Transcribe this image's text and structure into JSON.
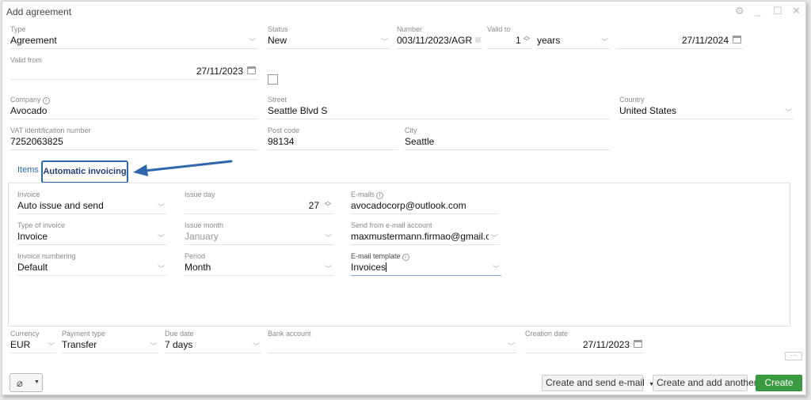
{
  "window": {
    "title": "Add agreement",
    "controls": [
      "⚙",
      "_",
      "☐",
      "✕"
    ]
  },
  "header": {
    "type": {
      "label": "Type",
      "value": "Agreement"
    },
    "status": {
      "label": "Status",
      "value": "New"
    },
    "number": {
      "label": "Number",
      "value": "003/11/2023/AGR"
    },
    "valid_to": {
      "label": "Valid to",
      "amount": "1",
      "unit": "years",
      "date": "27/11/2024"
    },
    "valid_from": {
      "label": "Valid from",
      "value": "27/11/2023"
    }
  },
  "company": {
    "company": {
      "label": "Company",
      "value": "Avocado"
    },
    "street": {
      "label": "Street",
      "value": "Seattle Blvd S"
    },
    "country": {
      "label": "Country",
      "value": "United States"
    },
    "vat": {
      "label": "VAT identification number",
      "value": "7252063825"
    },
    "post_code": {
      "label": "Post code",
      "value": "98134"
    },
    "city": {
      "label": "City",
      "value": "Seattle"
    }
  },
  "tabs": {
    "items": "Items",
    "automatic_invoicing": "Automatic invoicing"
  },
  "invoicing": {
    "invoice": {
      "label": "Invoice",
      "value": "Auto issue and send"
    },
    "issue_day": {
      "label": "Issue day",
      "value": "27"
    },
    "emails": {
      "label": "E-mails",
      "value": "avocadocorp@outlook.com"
    },
    "type_of_invoice": {
      "label": "Type of invoice",
      "value": "Invoice"
    },
    "issue_month": {
      "label": "Issue month",
      "value": "January"
    },
    "send_from": {
      "label": "Send from e-mail account",
      "value": "maxmustermann.firmao@gmail.co"
    },
    "invoice_numbering": {
      "label": "Invoice numbering",
      "value": "Default"
    },
    "period": {
      "label": "Period",
      "value": "Month"
    },
    "email_template": {
      "label": "E-mail template",
      "value": "Invoices"
    }
  },
  "footer": {
    "currency": {
      "label": "Currency",
      "value": "EUR"
    },
    "payment_type": {
      "label": "Payment type",
      "value": "Transfer"
    },
    "due_date": {
      "label": "Due date",
      "value": "7 days"
    },
    "bank_account": {
      "label": "Bank account",
      "value": ""
    },
    "creation_date": {
      "label": "Creation date",
      "value": "27/11/2023"
    },
    "more": "···"
  },
  "buttons": {
    "create_send_email": "Create and send e-mail",
    "create_add_another": "Create and add another",
    "create": "Create"
  },
  "colors": {
    "accent": "#2e66ad",
    "create_button": "#3a9a3f"
  }
}
